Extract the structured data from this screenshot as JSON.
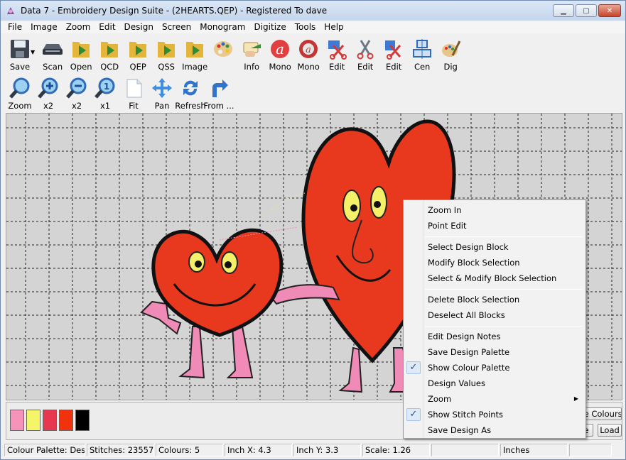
{
  "window": {
    "title": "Data 7 - Embroidery Design Suite - (2HEARTS.QEP) - Registered To dave",
    "controls": {
      "minimize": "▁",
      "maximize": "▢",
      "close": "✕"
    }
  },
  "menu": [
    "File",
    "Image",
    "Zoom",
    "Edit",
    "Design",
    "Screen",
    "Monogram",
    "Digitize",
    "Tools",
    "Help"
  ],
  "toolbar1": [
    {
      "label": "Save",
      "icon": "floppy-disk-icon"
    },
    {
      "label": "Scan",
      "icon": "scanner-icon"
    },
    {
      "label": "Open",
      "icon": "folder-open-icon"
    },
    {
      "label": "QCD",
      "icon": "folder-qcd-icon"
    },
    {
      "label": "QEP",
      "icon": "folder-qep-icon"
    },
    {
      "label": "QSS",
      "icon": "folder-qss-icon"
    },
    {
      "label": "Image",
      "icon": "folder-image-icon"
    },
    {
      "label": "",
      "icon": "palette-icon"
    },
    {
      "label": "Info",
      "icon": "info-hand-icon"
    },
    {
      "label": "Mono",
      "icon": "monogram-letter-icon"
    },
    {
      "label": "Mono",
      "icon": "monogram-gear-icon"
    },
    {
      "label": "Edit",
      "icon": "edit-scissors-blue-icon"
    },
    {
      "label": "Edit",
      "icon": "edit-scissors-icon"
    },
    {
      "label": "Edit",
      "icon": "edit-scissors-red-icon"
    },
    {
      "label": "Cen",
      "icon": "center-icon"
    },
    {
      "label": "Dig",
      "icon": "digitize-brush-icon"
    }
  ],
  "toolbar2": [
    {
      "label": "Zoom",
      "icon": "zoom-magnifier-icon"
    },
    {
      "label": "x2",
      "icon": "zoom-in-icon"
    },
    {
      "label": "x2",
      "icon": "zoom-out-icon"
    },
    {
      "label": "x1",
      "icon": "zoom-actual-icon"
    },
    {
      "label": "Fit",
      "icon": "fit-page-icon"
    },
    {
      "label": "Pan",
      "icon": "pan-arrows-icon"
    },
    {
      "label": "Refresh",
      "icon": "refresh-icon"
    },
    {
      "label": "From ...",
      "icon": "redirect-arrow-icon"
    }
  ],
  "palette": {
    "swatches": [
      "#f593b8",
      "#f5f56a",
      "#e8384f",
      "#f2320c",
      "#000000"
    ],
    "buttons": {
      "colours": "ne Colours",
      "save": "e",
      "load": "Load"
    }
  },
  "status": {
    "palette": "Colour Palette: Design",
    "stitches": "Stitches: 23557",
    "colours": "Colours: 5",
    "inch_x": "Inch X: 4.3",
    "inch_y": "Inch Y: 3.3",
    "scale": "Scale: 1.26",
    "blank1": "",
    "units": "Inches",
    "blank2": ""
  },
  "context_menu": {
    "zoom_in": "Zoom In",
    "point_edit": "Point Edit",
    "select_block": "Select Design Block",
    "modify_block": "Modify Block Selection",
    "select_modify": "Select & Modify Block Selection",
    "delete_block": "Delete Block Selection",
    "deselect_all": "Deselect All Blocks",
    "edit_notes": "Edit Design Notes",
    "save_palette": "Save Design Palette",
    "show_palette": "Show Colour Palette",
    "design_values": "Design Values",
    "zoom": "Zoom",
    "show_points": "Show Stitch Points",
    "save_as": "Save Design As"
  }
}
